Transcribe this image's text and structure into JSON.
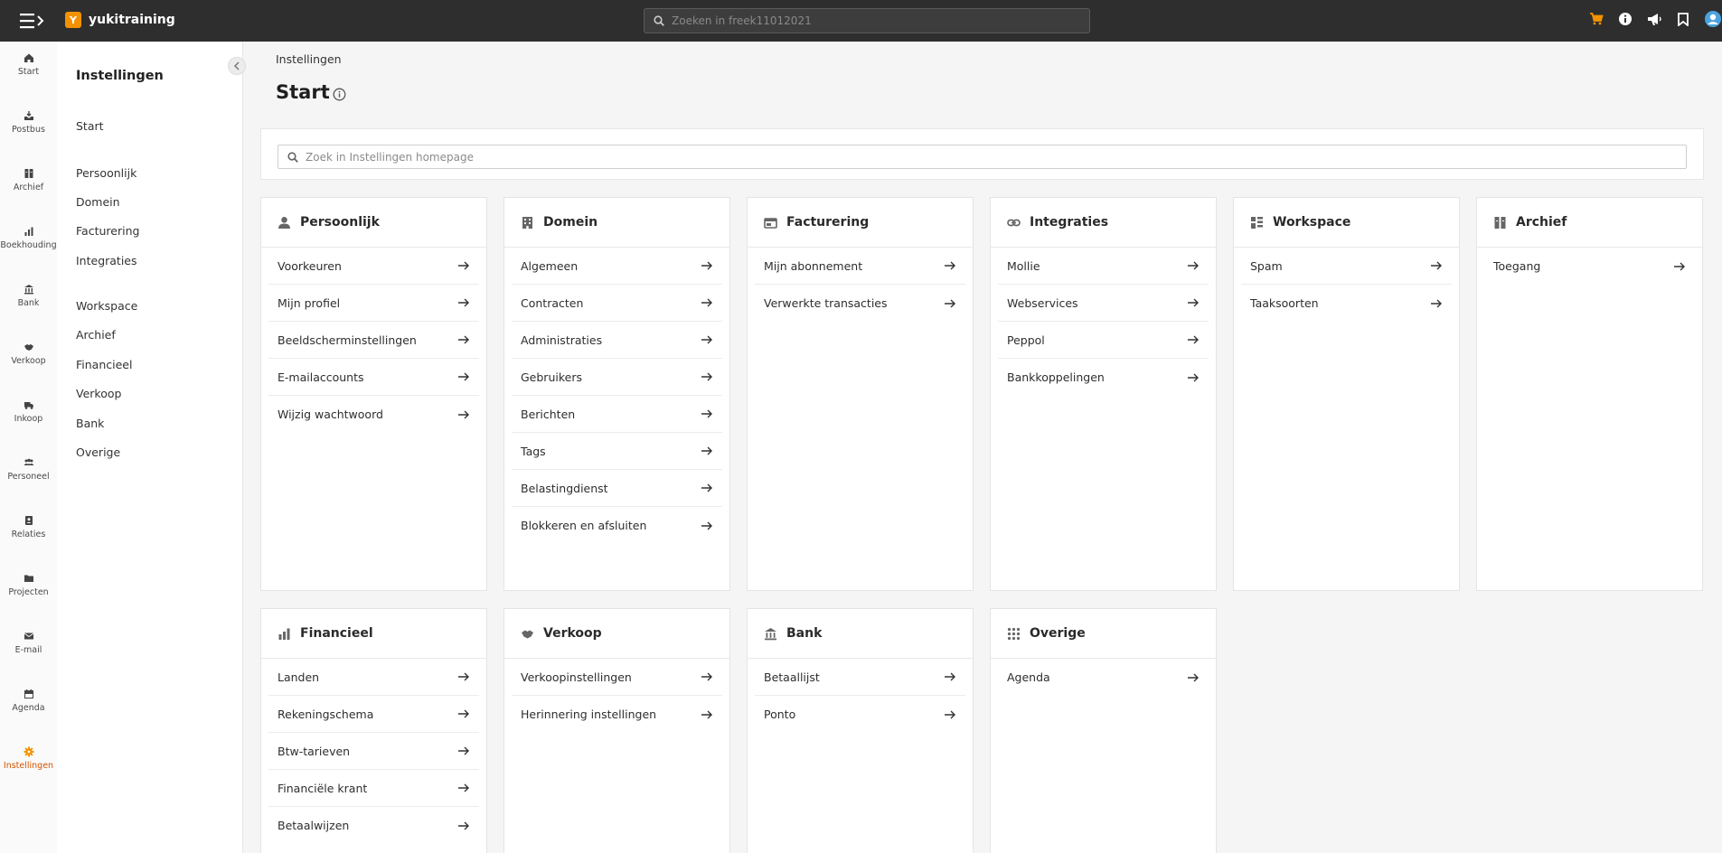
{
  "app": {
    "name": "yukitraining",
    "logo_letter": "Y",
    "search_placeholder": "Zoeken in freek11012021"
  },
  "rail": [
    {
      "label": "Start",
      "icon": "home-icon"
    },
    {
      "label": "Postbus",
      "icon": "inbox-icon"
    },
    {
      "label": "Archief",
      "icon": "archive-icon"
    },
    {
      "label": "Boekhouding",
      "icon": "chart-icon"
    },
    {
      "label": "Bank",
      "icon": "bank-icon"
    },
    {
      "label": "Verkoop",
      "icon": "handshake-icon"
    },
    {
      "label": "Inkoop",
      "icon": "truck-icon"
    },
    {
      "label": "Personeel",
      "icon": "people-icon"
    },
    {
      "label": "Relaties",
      "icon": "contact-icon"
    },
    {
      "label": "Projecten",
      "icon": "folder-icon"
    },
    {
      "label": "E-mail",
      "icon": "mail-icon"
    },
    {
      "label": "Agenda",
      "icon": "calendar-icon"
    },
    {
      "label": "Instellingen",
      "icon": "gear-icon",
      "active": true
    }
  ],
  "subnav": {
    "title": "Instellingen",
    "items": [
      "Start",
      "Persoonlijk",
      "Domein",
      "Facturering",
      "Integraties",
      "Workspace",
      "Archief",
      "Financieel",
      "Verkoop",
      "Bank",
      "Overige"
    ]
  },
  "main": {
    "breadcrumb": "Instellingen",
    "title": "Start",
    "search_placeholder": "Zoek in Instellingen homepage"
  },
  "cards": [
    {
      "title": "Persoonlijk",
      "icon": "person-icon",
      "items": [
        "Voorkeuren",
        "Mijn profiel",
        "Beeldscherminstellingen",
        "E-mailaccounts",
        "Wijzig wachtwoord"
      ]
    },
    {
      "title": "Domein",
      "icon": "building-icon",
      "items": [
        "Algemeen",
        "Contracten",
        "Administraties",
        "Gebruikers",
        "Berichten",
        "Tags",
        "Belastingdienst",
        "Blokkeren en afsluiten"
      ]
    },
    {
      "title": "Facturering",
      "icon": "billing-icon",
      "items": [
        "Mijn abonnement",
        "Verwerkte transacties"
      ]
    },
    {
      "title": "Integraties",
      "icon": "link-icon",
      "items": [
        "Mollie",
        "Webservices",
        "Peppol",
        "Bankkoppelingen"
      ]
    },
    {
      "title": "Workspace",
      "icon": "workspace-icon",
      "items": [
        "Spam",
        "Taaksoorten"
      ]
    },
    {
      "title": "Archief",
      "icon": "archive-icon",
      "items": [
        "Toegang"
      ]
    },
    {
      "title": "Financieel",
      "icon": "bar-chart-icon",
      "items": [
        "Landen",
        "Rekeningschema",
        "Btw-tarieven",
        "Financiële krant",
        "Betaalwijzen"
      ]
    },
    {
      "title": "Verkoop",
      "icon": "handshake-icon",
      "items": [
        "Verkoopinstellingen",
        "Herinnering instellingen"
      ]
    },
    {
      "title": "Bank",
      "icon": "bank-icon",
      "items": [
        "Betaallijst",
        "Ponto"
      ]
    },
    {
      "title": "Overige",
      "icon": "grid-icon",
      "items": [
        "Agenda"
      ]
    }
  ],
  "colors": {
    "topbar": "#2e2e2e",
    "accent": "#f39200",
    "active_nav": "#d45500"
  }
}
